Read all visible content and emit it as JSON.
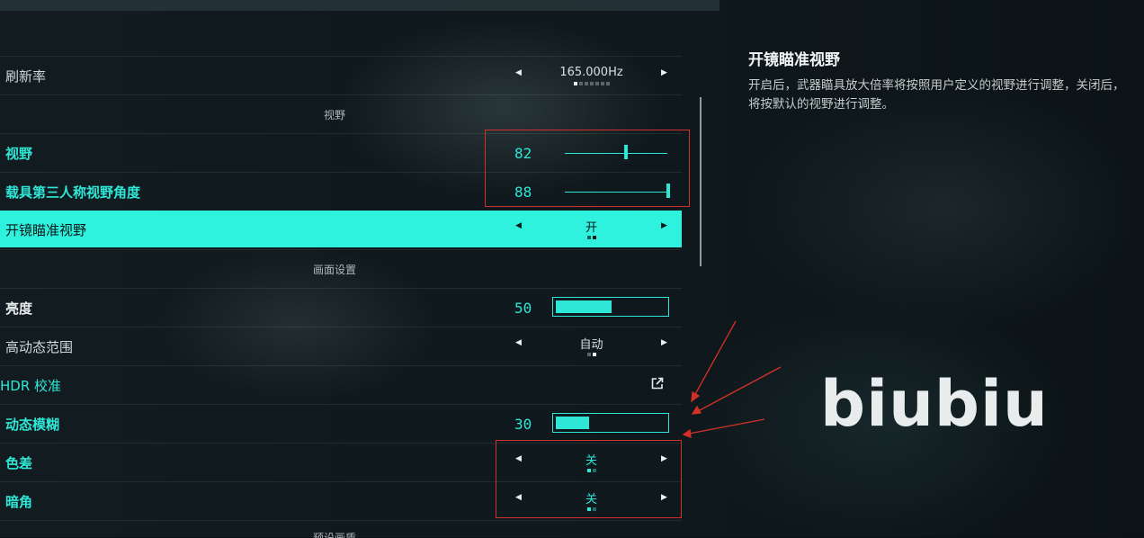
{
  "settings": {
    "refresh_rate": {
      "label": "刷新率",
      "value": "165.000Hz"
    },
    "section_fov": "视野",
    "fov": {
      "label": "视野",
      "value": "82",
      "level": 0.6
    },
    "vehicle_fov": {
      "label": "载具第三人称视野角度",
      "value": "88",
      "level": 1.0
    },
    "ads_fov": {
      "label": "开镜瞄准视野",
      "value": "开"
    },
    "section_graphics": "画面设置",
    "brightness": {
      "label": "亮度",
      "value": "50",
      "level": 0.5
    },
    "hdr": {
      "label": "高动态范围",
      "value": "自动"
    },
    "hdr_calibration": {
      "label": "HDR 校准"
    },
    "motion_blur": {
      "label": "动态模糊",
      "value": "30",
      "level": 0.3
    },
    "chromatic": {
      "label": "色差",
      "value": "关"
    },
    "vignette": {
      "label": "暗角",
      "value": "关"
    },
    "section_preset": "预设画质"
  },
  "info": {
    "title": "开镜瞄准视野",
    "description": "开启后，武器瞄具放大倍率将按照用户定义的视野进行调整，关闭后，将按默认的视野进行调整。"
  },
  "watermark": "biubiu",
  "colors": {
    "accent": "#2ff2de",
    "annotation": "#d4302a"
  }
}
